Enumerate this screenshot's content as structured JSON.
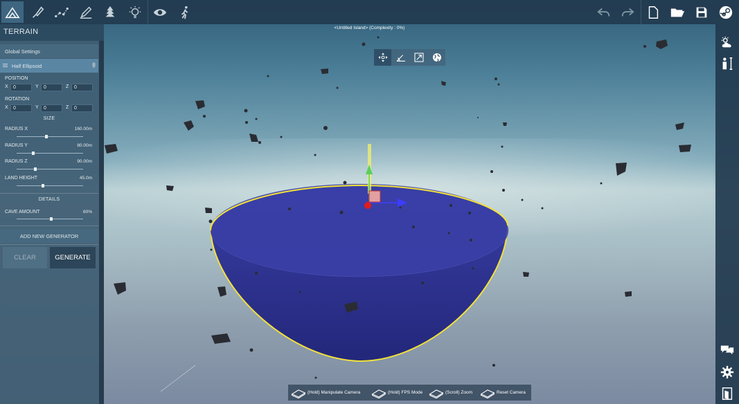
{
  "app": {
    "status_title": "<Untitled Island> (Complexity : 0%)"
  },
  "toolbar": {
    "tools": [
      {
        "icon": "terrain-icon",
        "active": true
      },
      {
        "icon": "brush-icon"
      },
      {
        "icon": "path-icon"
      },
      {
        "icon": "paint-icon"
      },
      {
        "icon": "tree-icon"
      },
      {
        "icon": "light-icon"
      },
      {
        "icon": "eye-icon"
      },
      {
        "icon": "walk-icon"
      }
    ],
    "right_tools": [
      "undo-icon",
      "redo-icon",
      "new-file-icon",
      "open-folder-icon",
      "save-icon",
      "steam-icon"
    ]
  },
  "sidebar_right": [
    "weather-icon",
    "scale-figure-icon",
    "chat-icon",
    "settings-icon",
    "exit-icon"
  ],
  "panel": {
    "title": "TERRAIN",
    "global_settings": "Global Settings",
    "generator": "Half Ellipsoid",
    "position_label": "POSITION",
    "rotation_label": "ROTATION",
    "axis_x": "X",
    "axis_y": "Y",
    "axis_z": "Z",
    "position": {
      "x": "0",
      "y": "0",
      "z": "0"
    },
    "rotation": {
      "x": "0",
      "y": "0",
      "z": "0"
    },
    "size_label": "SIZE",
    "sliders": [
      {
        "label": "RADIUS X",
        "value": "160.00m",
        "fraction": 0.45
      },
      {
        "label": "RADIUS Y",
        "value": "80.00m",
        "fraction": 0.25
      },
      {
        "label": "RADIUS Z",
        "value": "90.00m",
        "fraction": 0.28
      },
      {
        "label": "LAND HEIGHT",
        "value": "45.0m",
        "fraction": 0.4
      }
    ],
    "details_label": "DETAILS",
    "cave": {
      "label": "CAVE AMOUNT",
      "value": "60%",
      "fraction": 0.52
    },
    "add_generator": "ADD NEW GENERATOR",
    "clear": "CLEAR",
    "generate": "GENERATE"
  },
  "gizmo": [
    "move-icon",
    "rotate-icon",
    "scale-icon",
    "world-icon"
  ],
  "hints": [
    {
      "icon": "mouse-right-icon",
      "text": "(Hold) Manipulate Camera"
    },
    {
      "icon": "mouse-left-icon",
      "text": "(Hold) FPS Mode"
    },
    {
      "icon": "mouse-scroll-icon",
      "text": "(Scroll) Zoom"
    },
    {
      "icon": "mouse-middle-icon",
      "text": "Reset Camera"
    }
  ],
  "colors": {
    "island": "#2b2f8c",
    "outline": "#f2e13a",
    "panel": "#3e5c72",
    "toolbar": "#223a4e"
  }
}
